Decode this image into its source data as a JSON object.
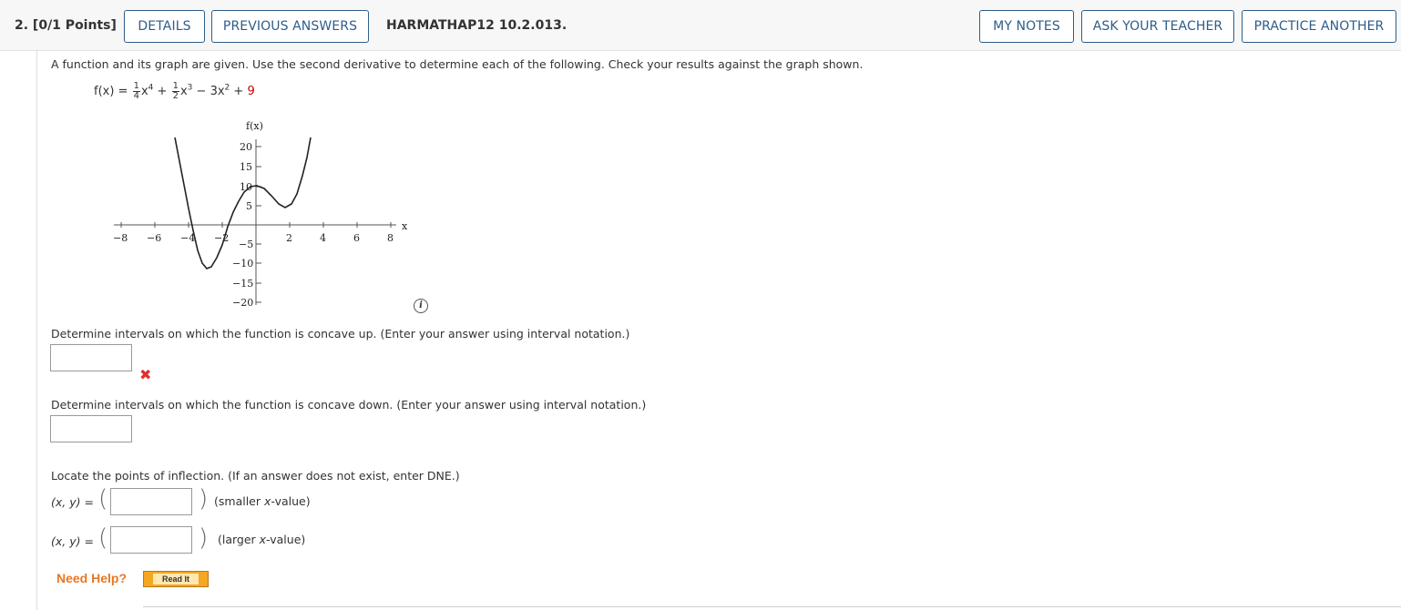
{
  "header": {
    "question_number": "2.  [0/1 Points]",
    "details_label": "DETAILS",
    "previous_answers_label": "PREVIOUS ANSWERS",
    "problem_code": "HARMATHAP12 10.2.013.",
    "my_notes_label": "MY NOTES",
    "ask_teacher_label": "ASK YOUR TEACHER",
    "practice_another_label": "PRACTICE ANOTHER"
  },
  "problem": {
    "intro": "A function and its graph are given. Use the second derivative to determine each of the following. Check your results against the graph shown.",
    "function_lhs": "f(x) =",
    "frac1_num": "1",
    "frac1_den": "4",
    "term1": "x",
    "term1_exp": "4",
    "plus1": "+",
    "frac2_num": "1",
    "frac2_den": "2",
    "term2": "x",
    "term2_exp": "3",
    "term3": "− 3x",
    "term3_exp": "2",
    "plus2": "+",
    "constant": "9"
  },
  "graph": {
    "y_axis_label": "f(x)",
    "x_axis_label": "x",
    "x_ticks": [
      "−8",
      "−6",
      "−4",
      "−2",
      "2",
      "4",
      "6",
      "8"
    ],
    "y_ticks": [
      "20",
      "15",
      "10",
      "5",
      "−5",
      "−10",
      "−15",
      "−20"
    ]
  },
  "questions": {
    "concave_up": "Determine intervals on which the function is concave up. (Enter your answer using interval notation.)",
    "concave_down": "Determine intervals on which the function is concave down. (Enter your answer using interval notation.)",
    "inflection": "Locate the points of inflection. (If an answer does not exist, enter DNE.)",
    "xy_label": "(x, y) =",
    "smaller_prefix": "(smaller ",
    "larger_prefix": "(larger ",
    "x_value": "x",
    "value_suffix": "-value)"
  },
  "help": {
    "need_help": "Need Help?",
    "read_it": "Read It"
  },
  "colors": {
    "accent": "#2d5d8a",
    "incorrect": "#e03030",
    "help": "#e87722",
    "constant_red": "#cc0000"
  }
}
